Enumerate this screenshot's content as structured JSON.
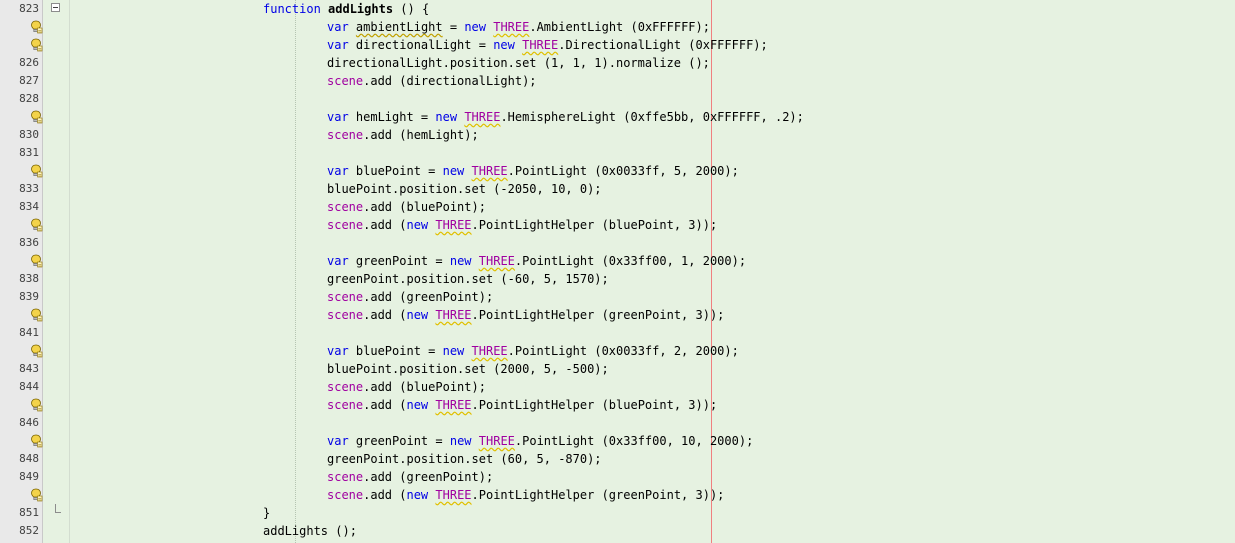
{
  "editor": {
    "colors": {
      "background": "#e6f2e1",
      "gutter": "#e9e9e9",
      "keyword": "#0000e6",
      "object": "#a000a0",
      "margin_line": "#f08080"
    },
    "lines": [
      {
        "num": "823",
        "fold": "start",
        "tokens": [
          {
            "t": "function",
            "c": "kw"
          },
          {
            "t": " "
          },
          {
            "t": "addLights",
            "c": "fn"
          },
          {
            "t": " () {"
          }
        ],
        "indent": 1
      },
      {
        "num": "",
        "hint": true,
        "tokens": [
          {
            "t": "var",
            "c": "kw"
          },
          {
            "t": " "
          },
          {
            "t": "ambientLight",
            "c": "warn"
          },
          {
            "t": " = "
          },
          {
            "t": "new",
            "c": "kw"
          },
          {
            "t": " "
          },
          {
            "t": "THREE",
            "c": "cls"
          },
          {
            "t": ".AmbientLight (0xFFFFFF);"
          }
        ],
        "indent": 2
      },
      {
        "num": "",
        "hint": true,
        "tokens": [
          {
            "t": "var",
            "c": "kw"
          },
          {
            "t": " directionalLight = "
          },
          {
            "t": "new",
            "c": "kw"
          },
          {
            "t": " "
          },
          {
            "t": "THREE",
            "c": "cls"
          },
          {
            "t": ".DirectionalLight (0xFFFFFF);"
          }
        ],
        "indent": 2
      },
      {
        "num": "826",
        "tokens": [
          {
            "t": "directionalLight.position.set (1, 1, 1).normalize ();"
          }
        ],
        "indent": 2
      },
      {
        "num": "827",
        "tokens": [
          {
            "t": "scene",
            "c": "obj"
          },
          {
            "t": ".add (directionalLight);"
          }
        ],
        "indent": 2
      },
      {
        "num": "828",
        "tokens": [],
        "indent": 2
      },
      {
        "num": "",
        "hint": true,
        "tokens": [
          {
            "t": "var",
            "c": "kw"
          },
          {
            "t": " hemLight = "
          },
          {
            "t": "new",
            "c": "kw"
          },
          {
            "t": " "
          },
          {
            "t": "THREE",
            "c": "cls"
          },
          {
            "t": ".HemisphereLight (0xffe5bb, 0xFFFFFF, .2);"
          }
        ],
        "indent": 2
      },
      {
        "num": "830",
        "tokens": [
          {
            "t": "scene",
            "c": "obj"
          },
          {
            "t": ".add (hemLight);"
          }
        ],
        "indent": 2
      },
      {
        "num": "831",
        "tokens": [],
        "indent": 2
      },
      {
        "num": "",
        "hint": true,
        "tokens": [
          {
            "t": "var",
            "c": "kw"
          },
          {
            "t": " bluePoint = "
          },
          {
            "t": "new",
            "c": "kw"
          },
          {
            "t": " "
          },
          {
            "t": "THREE",
            "c": "cls"
          },
          {
            "t": ".PointLight (0x0033ff, 5, 2000);"
          }
        ],
        "indent": 2
      },
      {
        "num": "833",
        "tokens": [
          {
            "t": "bluePoint.position.set (-2050, 10, 0);"
          }
        ],
        "indent": 2
      },
      {
        "num": "834",
        "tokens": [
          {
            "t": "scene",
            "c": "obj"
          },
          {
            "t": ".add (bluePoint);"
          }
        ],
        "indent": 2
      },
      {
        "num": "",
        "hint": true,
        "tokens": [
          {
            "t": "scene",
            "c": "obj"
          },
          {
            "t": ".add ("
          },
          {
            "t": "new",
            "c": "kw"
          },
          {
            "t": " "
          },
          {
            "t": "THREE",
            "c": "cls"
          },
          {
            "t": ".PointLightHelper (bluePoint, 3));"
          }
        ],
        "indent": 2
      },
      {
        "num": "836",
        "tokens": [],
        "indent": 2
      },
      {
        "num": "",
        "hint": true,
        "tokens": [
          {
            "t": "var",
            "c": "kw"
          },
          {
            "t": " greenPoint = "
          },
          {
            "t": "new",
            "c": "kw"
          },
          {
            "t": " "
          },
          {
            "t": "THREE",
            "c": "cls"
          },
          {
            "t": ".PointLight (0x33ff00, 1, 2000);"
          }
        ],
        "indent": 2
      },
      {
        "num": "838",
        "tokens": [
          {
            "t": "greenPoint.position.set (-60, 5, 1570);"
          }
        ],
        "indent": 2
      },
      {
        "num": "839",
        "tokens": [
          {
            "t": "scene",
            "c": "obj"
          },
          {
            "t": ".add (greenPoint);"
          }
        ],
        "indent": 2
      },
      {
        "num": "",
        "hint": true,
        "tokens": [
          {
            "t": "scene",
            "c": "obj"
          },
          {
            "t": ".add ("
          },
          {
            "t": "new",
            "c": "kw"
          },
          {
            "t": " "
          },
          {
            "t": "THREE",
            "c": "cls"
          },
          {
            "t": ".PointLightHelper (greenPoint, 3));"
          }
        ],
        "indent": 2
      },
      {
        "num": "841",
        "tokens": [],
        "indent": 2
      },
      {
        "num": "",
        "hint": true,
        "tokens": [
          {
            "t": "var",
            "c": "kw"
          },
          {
            "t": " bluePoint = "
          },
          {
            "t": "new",
            "c": "kw"
          },
          {
            "t": " "
          },
          {
            "t": "THREE",
            "c": "cls"
          },
          {
            "t": ".PointLight (0x0033ff, 2, 2000);"
          }
        ],
        "indent": 2
      },
      {
        "num": "843",
        "tokens": [
          {
            "t": "bluePoint.position.set (2000, 5, -500);"
          }
        ],
        "indent": 2
      },
      {
        "num": "844",
        "tokens": [
          {
            "t": "scene",
            "c": "obj"
          },
          {
            "t": ".add (bluePoint);"
          }
        ],
        "indent": 2
      },
      {
        "num": "",
        "hint": true,
        "tokens": [
          {
            "t": "scene",
            "c": "obj"
          },
          {
            "t": ".add ("
          },
          {
            "t": "new",
            "c": "kw"
          },
          {
            "t": " "
          },
          {
            "t": "THREE",
            "c": "cls"
          },
          {
            "t": ".PointLightHelper (bluePoint, 3));"
          }
        ],
        "indent": 2
      },
      {
        "num": "846",
        "tokens": [],
        "indent": 2
      },
      {
        "num": "",
        "hint": true,
        "tokens": [
          {
            "t": "var",
            "c": "kw"
          },
          {
            "t": " greenPoint = "
          },
          {
            "t": "new",
            "c": "kw"
          },
          {
            "t": " "
          },
          {
            "t": "THREE",
            "c": "cls"
          },
          {
            "t": ".PointLight (0x33ff00, 10, 2000);"
          }
        ],
        "indent": 2
      },
      {
        "num": "848",
        "tokens": [
          {
            "t": "greenPoint.position.set (60, 5, -870);"
          }
        ],
        "indent": 2
      },
      {
        "num": "849",
        "tokens": [
          {
            "t": "scene",
            "c": "obj"
          },
          {
            "t": ".add (greenPoint);"
          }
        ],
        "indent": 2
      },
      {
        "num": "",
        "hint": true,
        "tokens": [
          {
            "t": "scene",
            "c": "obj"
          },
          {
            "t": ".add ("
          },
          {
            "t": "new",
            "c": "kw"
          },
          {
            "t": " "
          },
          {
            "t": "THREE",
            "c": "cls"
          },
          {
            "t": ".PointLightHelper (greenPoint, 3));"
          }
        ],
        "indent": 2
      },
      {
        "num": "851",
        "fold": "end",
        "tokens": [
          {
            "t": "}"
          }
        ],
        "indent": 1
      },
      {
        "num": "852",
        "tokens": [
          {
            "t": "addLights ();"
          }
        ],
        "indent": 1
      }
    ]
  }
}
